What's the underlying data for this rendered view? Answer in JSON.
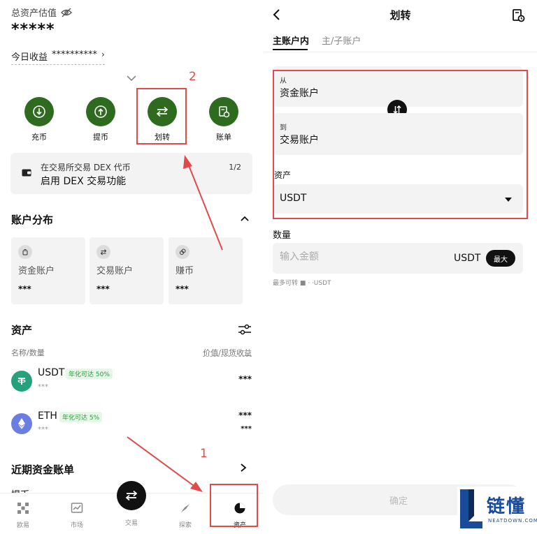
{
  "left": {
    "total_label": "总资产估值",
    "total_value": "*****",
    "today_label": "今日收益",
    "today_value": "**********",
    "actions": [
      {
        "label": "充币",
        "icon": "download-icon"
      },
      {
        "label": "提币",
        "icon": "upload-icon"
      },
      {
        "label": "划转",
        "icon": "transfer-icon"
      },
      {
        "label": "账单",
        "icon": "bill-icon"
      }
    ],
    "annotations": [
      "2",
      "1"
    ],
    "dex_card": {
      "line1": "在交易所交易 DEX 代币",
      "line2": "启用 DEX 交易功能",
      "pager": "1/2"
    },
    "distribution_title": "账户分布",
    "accounts": [
      {
        "name": "资金账户",
        "value": "***",
        "icon": "wallet-bag-icon"
      },
      {
        "name": "交易账户",
        "value": "***",
        "icon": "swap-icon"
      },
      {
        "name": "赚币",
        "value": "***",
        "icon": "coins-icon"
      }
    ],
    "assets_title": "资产",
    "col_left": "名称/数量",
    "col_right": "价值/现货收益",
    "assets": [
      {
        "name": "USDT",
        "badge": "年化可达 50%",
        "sub": "***",
        "right1": "***",
        "right2": ""
      },
      {
        "name": "ETH",
        "badge": "年化可达 5%",
        "sub": "***",
        "right1": "***",
        "right2": "***"
      }
    ],
    "recent_title": "近期资金账单",
    "recent_peek": "提币",
    "nav": [
      {
        "label": "欧易",
        "icon": "okx-logo-icon"
      },
      {
        "label": "市场",
        "icon": "chart-icon"
      },
      {
        "label": "交易",
        "icon": "trade-icon"
      },
      {
        "label": "探索",
        "icon": "compass-icon"
      },
      {
        "label": "资产",
        "icon": "pie-chart-icon"
      }
    ],
    "annotation_color": "#e04a4a",
    "accent": "#2f6b1f"
  },
  "right": {
    "title": "划转",
    "tabs": [
      "主账户内",
      "主/子账户"
    ],
    "from_label": "从",
    "from_value": "资金账户",
    "to_label": "到",
    "to_value": "交易账户",
    "asset_label": "资产",
    "asset_value": "USDT",
    "qty_label": "数量",
    "amount_placeholder": "输入金额",
    "unit": "USDT",
    "max_label": "最大",
    "available": "最多可转 ■ · ·USDT",
    "confirm": "确定",
    "logo_text": "链懂",
    "logo_sub": "NEATDOWN.COM"
  }
}
